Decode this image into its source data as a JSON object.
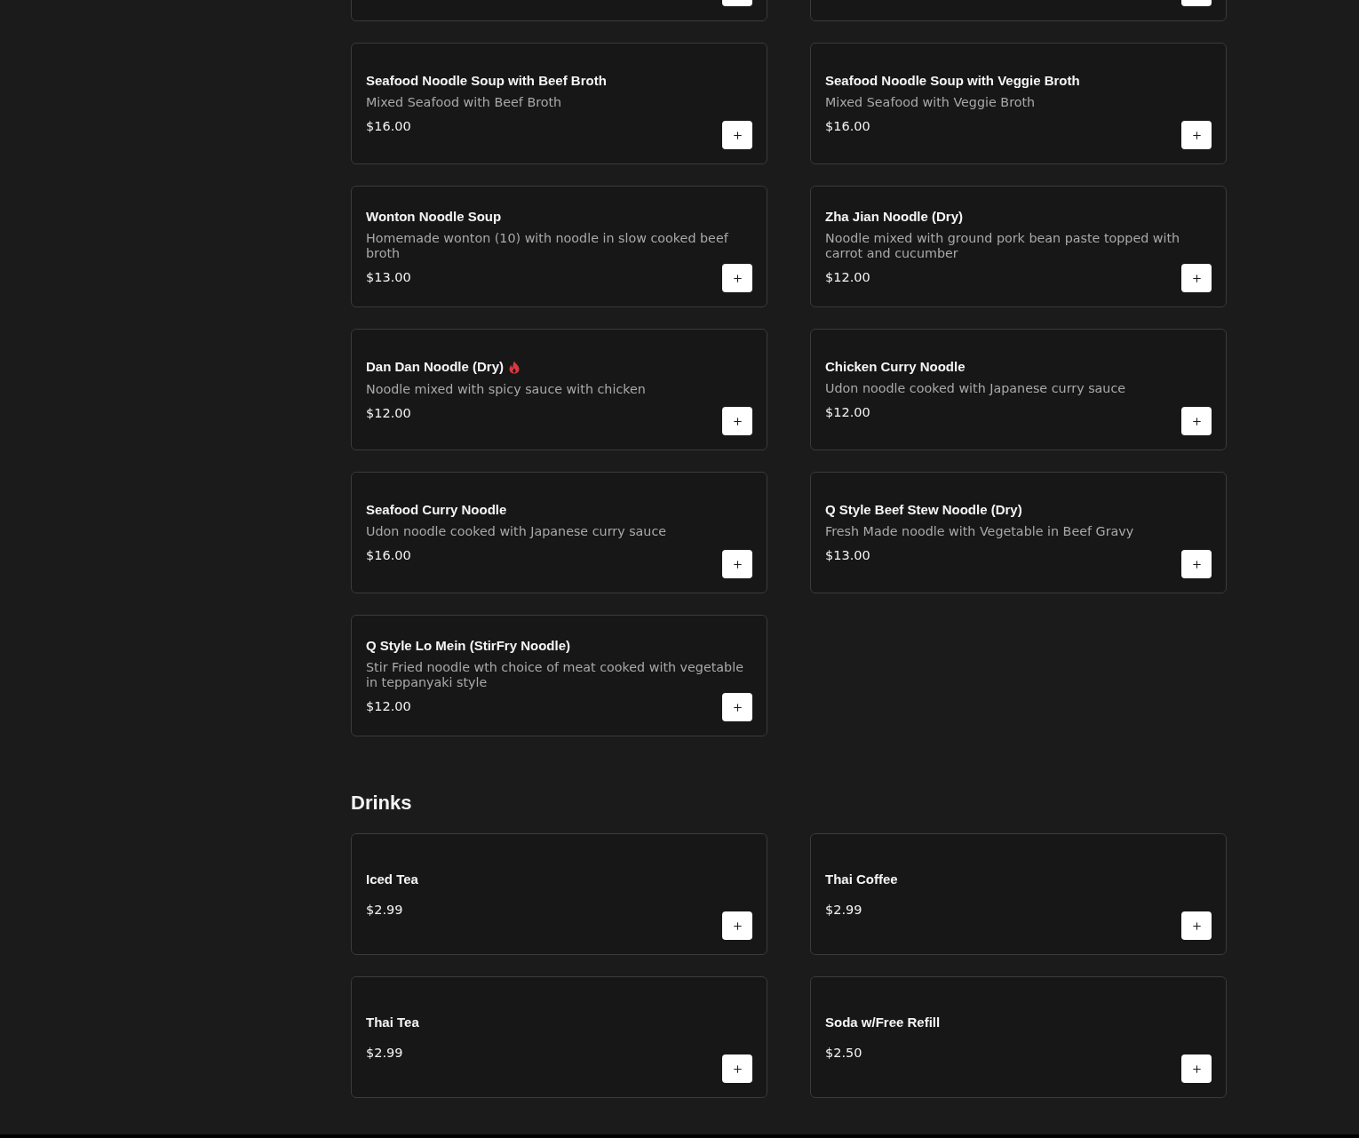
{
  "sections": [
    {
      "items": [
        {
          "kind": "cut_off"
        },
        {
          "kind": "cut_off"
        },
        {
          "kind": "dish",
          "name": "Seafood Noodle Soup with Beef Broth",
          "description": "Mixed Seafood with Beef Broth",
          "price": "$16.00",
          "spicy": false
        },
        {
          "kind": "dish",
          "name": "Seafood Noodle Soup with Veggie Broth",
          "description": "Mixed Seafood with Veggie Broth",
          "price": "$16.00",
          "spicy": false
        },
        {
          "kind": "dish",
          "name": "Wonton Noodle Soup",
          "description": "Homemade wonton (10) with noodle in slow cooked beef broth",
          "price": "$13.00",
          "spicy": false
        },
        {
          "kind": "dish",
          "name": "Zha Jian Noodle (Dry)",
          "description": "Noodle mixed with ground pork bean paste topped with carrot and cucumber",
          "price": "$12.00",
          "spicy": false
        },
        {
          "kind": "dish",
          "name": "Dan Dan Noodle (Dry)",
          "description": "Noodle mixed with spicy sauce with chicken",
          "price": "$12.00",
          "spicy": true
        },
        {
          "kind": "dish",
          "name": "Chicken Curry Noodle",
          "description": "Udon noodle cooked with Japanese curry sauce",
          "price": "$12.00",
          "spicy": false
        },
        {
          "kind": "dish",
          "name": "Seafood Curry Noodle",
          "description": "Udon noodle cooked with Japanese curry sauce",
          "price": "$16.00",
          "spicy": false
        },
        {
          "kind": "dish",
          "name": "Q Style Beef Stew Noodle (Dry)",
          "description": "Fresh Made noodle with Vegetable in Beef Gravy",
          "price": "$13.00",
          "spicy": false
        },
        {
          "kind": "dish",
          "name": "Q Style Lo Mein (StirFry Noodle)",
          "description": "Stir Fried noodle wth choice of meat cooked with vegetable in teppanyaki style",
          "price": "$12.00",
          "spicy": false
        }
      ]
    },
    {
      "title": "Drinks",
      "items": [
        {
          "kind": "dish",
          "name": "Iced Tea",
          "price": "$2.99",
          "spicy": false
        },
        {
          "kind": "dish",
          "name": "Thai Coffee",
          "price": "$2.99",
          "spicy": false
        },
        {
          "kind": "dish",
          "name": "Thai Tea",
          "price": "$2.99",
          "spicy": false
        },
        {
          "kind": "dish",
          "name": "Soda w/Free Refill",
          "price": "$2.50",
          "spicy": false
        }
      ]
    }
  ]
}
